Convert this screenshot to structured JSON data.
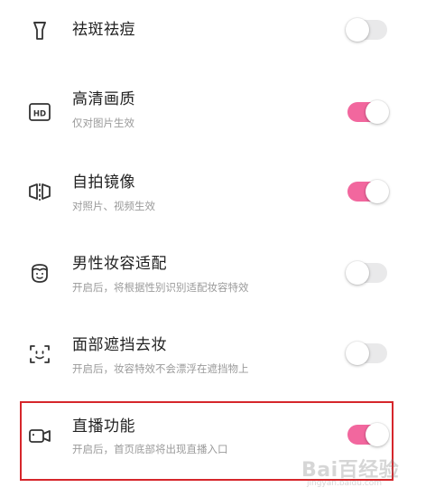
{
  "settings": [
    {
      "title": "祛斑祛痘",
      "subtitle": "",
      "icon": "spot-removal-icon",
      "enabled": false
    },
    {
      "title": "高清画质",
      "subtitle": "仅对图片生效",
      "icon": "hd-icon",
      "enabled": true
    },
    {
      "title": "自拍镜像",
      "subtitle": "对照片、视频生效",
      "icon": "mirror-icon",
      "enabled": true
    },
    {
      "title": "男性妆容适配",
      "subtitle": "开启后，将根据性别识别适配妆容特效",
      "icon": "male-face-icon",
      "enabled": false
    },
    {
      "title": "面部遮挡去妆",
      "subtitle": "开启后，妆容特效不会漂浮在遮挡物上",
      "icon": "face-scan-icon",
      "enabled": false
    },
    {
      "title": "直播功能",
      "subtitle": "开启后，首页底部将出现直播入口",
      "icon": "video-camera-icon",
      "enabled": true
    }
  ],
  "icons": {
    "hd_text": "HD"
  },
  "colors": {
    "toggle_on": "#f2679e",
    "toggle_off": "#e9e9ea",
    "highlight_border": "#d6262b",
    "title_text": "#222222",
    "subtitle_text": "#9a9a9a"
  },
  "watermark": {
    "main": "Bai百经验",
    "sub": "jingyan.baidu.com"
  }
}
